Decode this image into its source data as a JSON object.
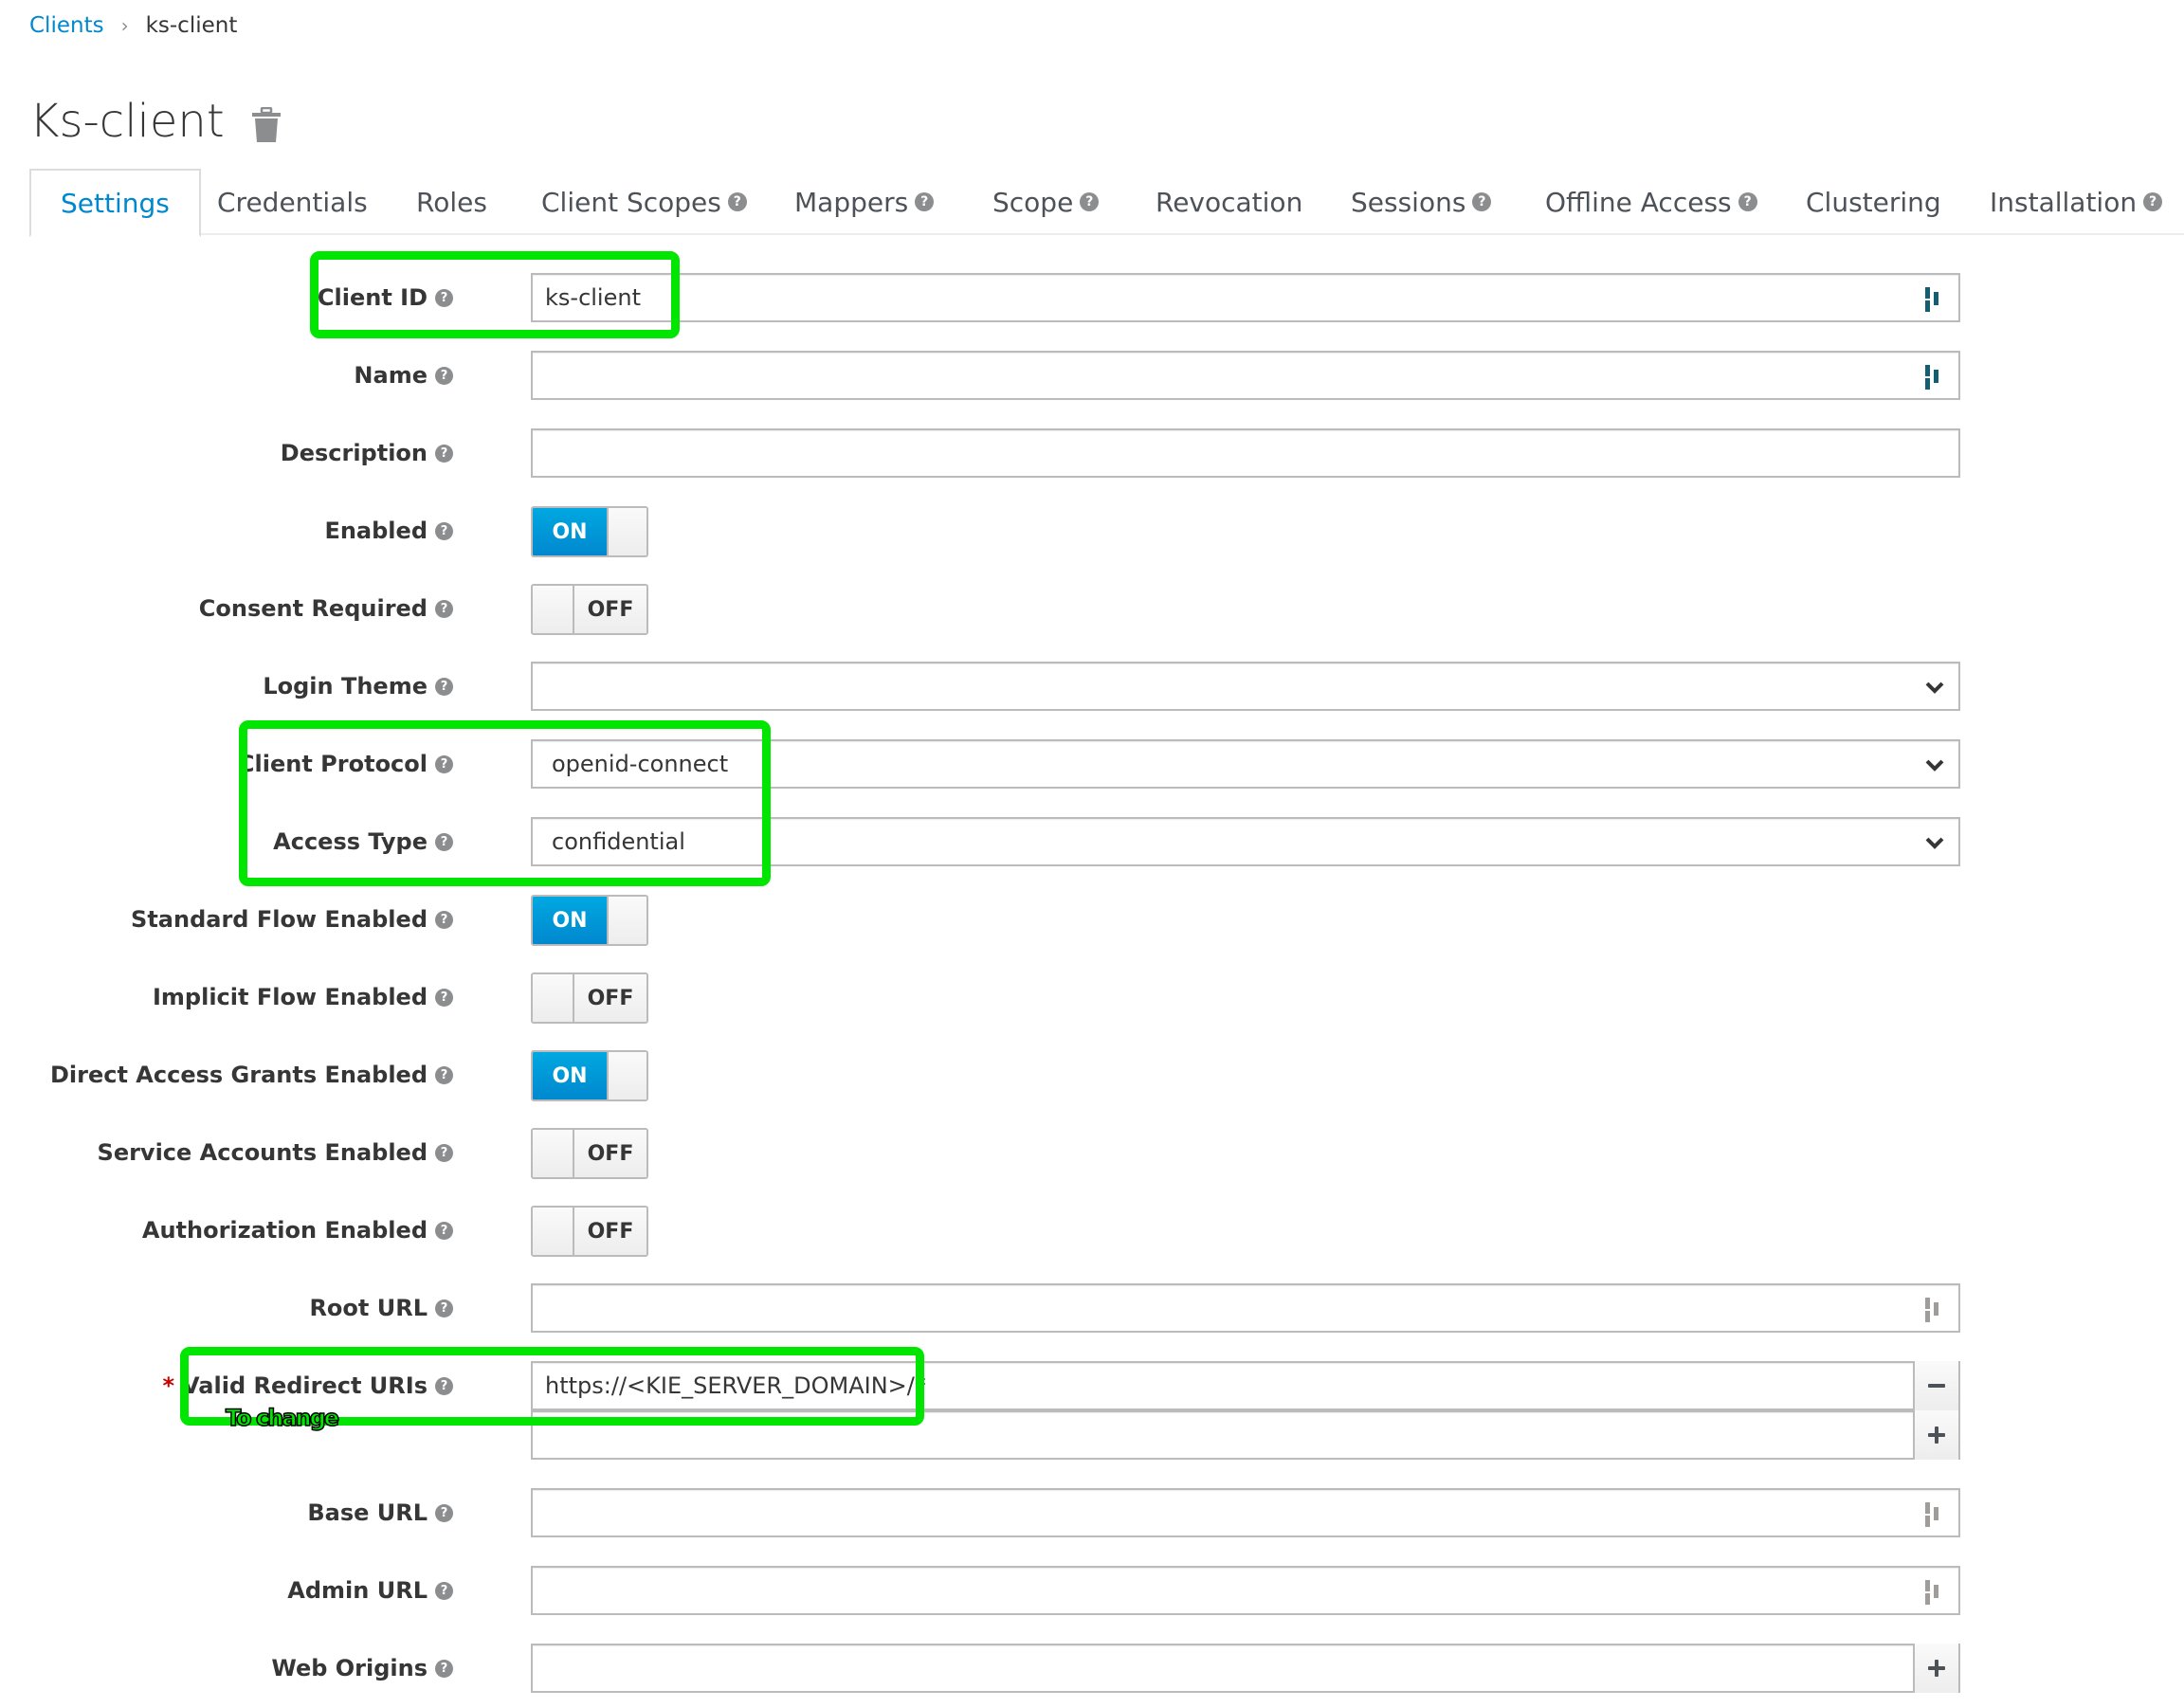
{
  "breadcrumb": {
    "parent": "Clients",
    "separator": "›",
    "current": "ks-client"
  },
  "page": {
    "title": "Ks-client",
    "delete_icon": "trash-icon"
  },
  "tabs": [
    {
      "label": "Settings",
      "active": true,
      "help": false
    },
    {
      "label": "Credentials",
      "help": false
    },
    {
      "label": "Roles",
      "help": false
    },
    {
      "label": "Client Scopes",
      "help": true
    },
    {
      "label": "Mappers",
      "help": true
    },
    {
      "label": "Scope",
      "help": true
    },
    {
      "label": "Revocation",
      "help": false
    },
    {
      "label": "Sessions",
      "help": true
    },
    {
      "label": "Offline Access",
      "help": true
    },
    {
      "label": "Clustering",
      "help": false
    },
    {
      "label": "Installation",
      "help": true
    }
  ],
  "help_glyph": "?",
  "form": {
    "client_id": {
      "label": "Client ID",
      "value": "ks-client"
    },
    "name": {
      "label": "Name",
      "value": ""
    },
    "description": {
      "label": "Description",
      "value": ""
    },
    "enabled": {
      "label": "Enabled",
      "state": "ON"
    },
    "consent_required": {
      "label": "Consent Required",
      "state": "OFF"
    },
    "login_theme": {
      "label": "Login Theme",
      "value": ""
    },
    "client_protocol": {
      "label": "Client Protocol",
      "value": "openid-connect"
    },
    "access_type": {
      "label": "Access Type",
      "value": "confidential"
    },
    "standard_flow": {
      "label": "Standard Flow Enabled",
      "state": "ON"
    },
    "implicit_flow": {
      "label": "Implicit Flow Enabled",
      "state": "OFF"
    },
    "direct_access": {
      "label": "Direct Access Grants Enabled",
      "state": "ON"
    },
    "service_accounts": {
      "label": "Service Accounts Enabled",
      "state": "OFF"
    },
    "authorization": {
      "label": "Authorization Enabled",
      "state": "OFF"
    },
    "root_url": {
      "label": "Root URL",
      "value": ""
    },
    "valid_redirect_uris": {
      "label": "Valid Redirect URIs",
      "required_mark": "*",
      "values": [
        "https://<KIE_SERVER_DOMAIN>/*",
        ""
      ]
    },
    "base_url": {
      "label": "Base URL",
      "value": ""
    },
    "admin_url": {
      "label": "Admin URL",
      "value": ""
    },
    "web_origins": {
      "label": "Web Origins",
      "value": ""
    }
  },
  "annotation": {
    "text": "To change",
    "highlight_color": "#00e600"
  },
  "colors": {
    "link": "#0088ce",
    "toggle_on": "#0088ce",
    "required": "#cc0000"
  }
}
